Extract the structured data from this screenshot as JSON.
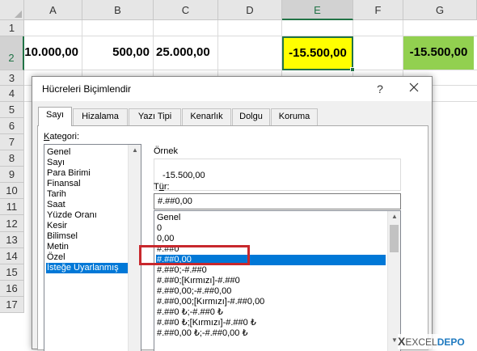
{
  "sheet": {
    "columns": [
      "A",
      "B",
      "C",
      "D",
      "E",
      "F",
      "G"
    ],
    "rows": [
      "1",
      "2",
      "3",
      "4",
      "5",
      "6",
      "7",
      "8",
      "9",
      "10",
      "11",
      "12",
      "13",
      "14",
      "15",
      "16",
      "17"
    ],
    "cells": {
      "A2": "10.000,00",
      "B2": "500,00",
      "C2": "25.000,00",
      "E2": "-15.500,00",
      "G2": "-15.500,00"
    },
    "colors": {
      "e2_fill": "#ffff00",
      "g2_fill": "#92d050",
      "selection_border": "#217346"
    }
  },
  "dialog": {
    "title": "Hücreleri Biçimlendir",
    "help": "?",
    "tabs": [
      "Sayı",
      "Hizalama",
      "Yazı Tipi",
      "Kenarlık",
      "Dolgu",
      "Koruma"
    ],
    "active_tab": "Sayı",
    "category_label_key": "K",
    "category_label_rest": "ategori:",
    "categories": [
      "Genel",
      "Sayı",
      "Para Birimi",
      "Finansal",
      "Tarih",
      "Saat",
      "Yüzde Oranı",
      "Kesir",
      "Bilimsel",
      "Metin",
      "Özel",
      "İsteğe Uyarlanmış"
    ],
    "selected_category": "İsteğe Uyarlanmış",
    "sample_label": "Örnek",
    "sample_value": "-15.500,00",
    "type_label_pre": "T",
    "type_label_key": "ü",
    "type_label_post": "r:",
    "type_value": "#.##0,00",
    "formats": [
      "Genel",
      "0",
      "0,00",
      "#.##0",
      "#.##0,00",
      "#.##0;-#.##0",
      "#.##0;[Kırmızı]-#.##0",
      "#.##0,00;-#.##0,00",
      "#.##0,00;[Kırmızı]-#.##0,00",
      "#.##0 ₺;-#.##0 ₺",
      "#.##0 ₺;[Kırmızı]-#.##0 ₺",
      "#.##0,00 ₺;-#.##0,00 ₺"
    ],
    "selected_format": "#.##0,00",
    "highlight_color": "#c8282d",
    "accent_color": "#0078d7"
  },
  "watermark": {
    "prefix": "X",
    "excel": "EXCEL",
    "depo": "DEPO"
  }
}
